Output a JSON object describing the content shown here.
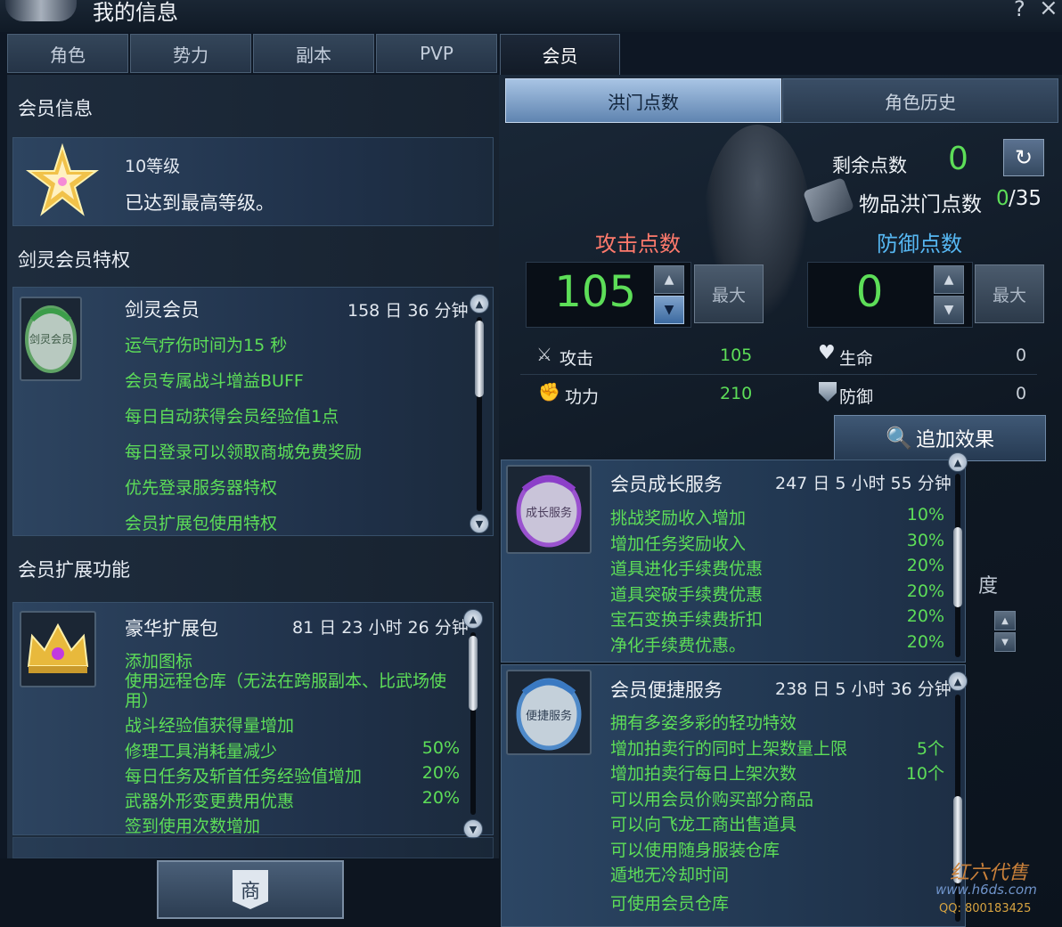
{
  "window": {
    "title": "我的信息",
    "help": "?",
    "close": "×"
  },
  "main_tabs": [
    "角色",
    "势力",
    "副本",
    "PVP",
    "会员"
  ],
  "left": {
    "member_info": {
      "title": "会员信息",
      "level": "10等级",
      "status": "已达到最高等级。"
    },
    "privileges": {
      "title": "剑灵会员特权",
      "card": {
        "name": "剑灵会员",
        "icon_text": "剑灵会员",
        "time": "158 日 36 分钟",
        "items": [
          "运气疗伤时间为15 秒",
          "会员专属战斗增益BUFF",
          "每日自动获得会员经验值1点",
          "每日登录可以领取商城免费奖励",
          "优先登录服务器特权",
          "会员扩展包使用特权"
        ]
      }
    },
    "extension": {
      "title": "会员扩展功能",
      "card": {
        "name": "豪华扩展包",
        "time": "81 日 23 小时 26 分钟",
        "items": [
          {
            "text": "添加图标",
            "value": ""
          },
          {
            "text": "使用远程仓库（无法在跨服副本、比武场使用）",
            "value": ""
          },
          {
            "text": "战斗经验值获得量增加",
            "value": ""
          },
          {
            "text": "修理工具消耗量减少",
            "value": "50%"
          },
          {
            "text": "每日任务及斩首任务经验值增加",
            "value": "20%"
          },
          {
            "text": "武器外形变更费用优惠",
            "value": "20%"
          },
          {
            "text": "签到使用次数增加",
            "value": ""
          }
        ]
      }
    },
    "shop_button": "商"
  },
  "right": {
    "sub_tabs": [
      "洪门点数",
      "角色历史"
    ],
    "remaining_label": "剩余点数",
    "remaining_value": "0",
    "item_points_label": "物品洪门点数",
    "item_points_current": "0",
    "item_points_max": "/35",
    "attack": {
      "label": "攻击点数",
      "value": "105",
      "max": "最大"
    },
    "defense": {
      "label": "防御点数",
      "value": "0",
      "max": "最大"
    },
    "stats": [
      {
        "name": "攻击",
        "value": "105",
        "icon": "swords-icon"
      },
      {
        "name": "生命",
        "value": "0",
        "icon": "heart-icon"
      },
      {
        "name": "功力",
        "value": "210",
        "icon": "fist-icon"
      },
      {
        "name": "防御",
        "value": "0",
        "icon": "shield-icon"
      }
    ],
    "add_effect": "追加效果",
    "growth": {
      "name": "会员成长服务",
      "icon_text": "成长服务",
      "time": "247 日 5 小时 55 分钟",
      "items": [
        {
          "text": "挑战奖励收入增加",
          "value": "10%"
        },
        {
          "text": "增加任务奖励收入",
          "value": "30%"
        },
        {
          "text": "道具进化手续费优惠",
          "value": "20%"
        },
        {
          "text": "道具突破手续费优惠",
          "value": "20%"
        },
        {
          "text": "宝石变换手续费折扣",
          "value": "20%"
        },
        {
          "text": "净化手续费优惠。",
          "value": "20%"
        }
      ]
    },
    "convenience": {
      "name": "会员便捷服务",
      "icon_text": "便捷服务",
      "time": "238 日 5 小时 36 分钟",
      "items": [
        {
          "text": "拥有多姿多彩的轻功特效",
          "value": ""
        },
        {
          "text": "增加拍卖行的同时上架数量上限",
          "value": "5个"
        },
        {
          "text": "增加拍卖行每日上架次数",
          "value": "10个"
        },
        {
          "text": "可以用会员价购买部分商品",
          "value": ""
        },
        {
          "text": "可以向飞龙工商出售道具",
          "value": ""
        },
        {
          "text": "可以使用随身服装仓库",
          "value": ""
        },
        {
          "text": "遁地无冷却时间",
          "value": ""
        },
        {
          "text": "可使用会员仓库",
          "value": ""
        }
      ]
    },
    "partial_label": "度"
  },
  "watermark": {
    "line1": "红六代售",
    "line2": "www.h6ds.com",
    "line3": "QQ: 800183425"
  },
  "colors": {
    "green": "#5dde58",
    "attack_red": "#ff7a6c",
    "defense_blue": "#56b7f2"
  }
}
